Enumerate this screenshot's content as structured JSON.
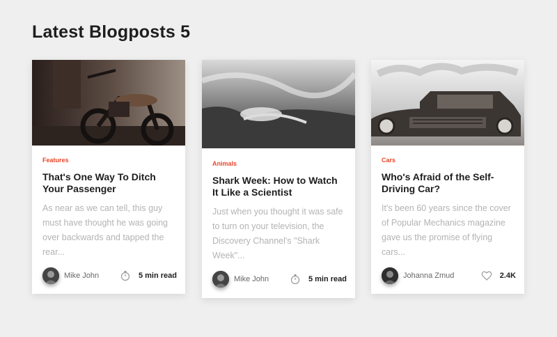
{
  "page": {
    "title": "Latest Blogposts 5"
  },
  "cards": [
    {
      "category": "Features",
      "title": "That's One Way To Ditch Your Passenger",
      "excerpt": "As near as we can tell, this guy must have thought he was going over backwards and tapped the rear...",
      "author": "Mike John",
      "meta": "5 min read",
      "meta_icon": "stopwatch-icon"
    },
    {
      "category": "Animals",
      "title": "Shark Week: How to Watch It Like a Scientist",
      "excerpt": "Just when you thought it was safe to turn on your television, the Discovery Channel's \"Shark Week\"...",
      "author": "Mike John",
      "meta": "5 min read",
      "meta_icon": "stopwatch-icon"
    },
    {
      "category": "Cars",
      "title": "Who's Afraid of the Self-Driving Car?",
      "excerpt": "It's been 60 years since the cover of Popular Mechanics magazine gave us the promise of flying cars...",
      "author": "Johanna Zmud",
      "meta": "2.4K",
      "meta_icon": "heart-icon"
    }
  ],
  "colors": {
    "accent": "#e8462a",
    "background": "#efefef",
    "card": "#ffffff",
    "muted_text": "#b3b3b3"
  }
}
